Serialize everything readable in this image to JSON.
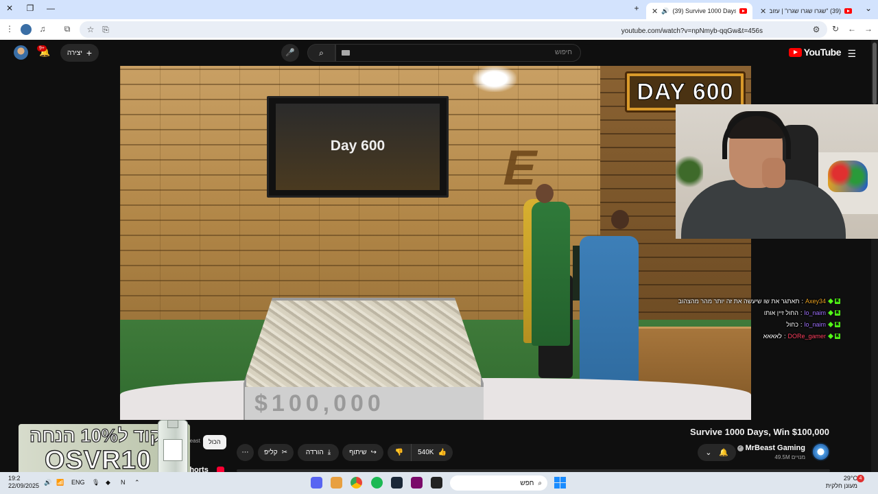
{
  "browser": {
    "tabs": [
      {
        "title": "(39) Survive 1000 Days, Win"
      },
      {
        "title": "(39) \"שגרו שגרו שגרו\" | עזוב זה"
      }
    ],
    "url": "youtube.com/watch?v=npNmyb-qqGw&t=456s"
  },
  "youtube": {
    "logo": "YouTube",
    "search_placeholder": "חיפוש",
    "create_label": "יצירה",
    "notification_count": "9+"
  },
  "video": {
    "day_badge": "DAY 600",
    "tv_text": "Day 600",
    "cash_text": "$100,000"
  },
  "chat": [
    {
      "user": "Axey34",
      "user_color": "#e8a020",
      "message": "תאתגר את שו שיעשה את זה יותר מהר מהצהוב"
    },
    {
      "user": "lo_naim",
      "user_color": "#a070ff",
      "message": "החול זיין אותו"
    },
    {
      "user": "lo_naim",
      "user_color": "#a070ff",
      "message": "כחול"
    },
    {
      "user": "DORe_gamer",
      "user_color": "#ff4060",
      "message": "לאאאא"
    }
  ],
  "details": {
    "title": "Survive 1000 Days, Win $100,000",
    "channel": "MrBeast Gaming",
    "subscribers": "49.5M מנויים",
    "likes": "540K",
    "share_label": "שיתוף",
    "download_label": "הורדה",
    "clip_label": "קליפ",
    "filter_all": "הכול",
    "shorts_label": "Shorts",
    "side_text": "MrBeast"
  },
  "promo": {
    "line1": "קוד ל10% הנחה",
    "line2": "OSVR10"
  },
  "taskbar": {
    "search_label": "חפש",
    "time": "19:2",
    "date": "22/09/2025",
    "lang": "ENG",
    "temperature": "29°C",
    "weather": "מעונן חלקית",
    "notif_count": "4"
  },
  "colors": {
    "accent_red": "#ff0000",
    "kick_green": "#53fc18"
  }
}
